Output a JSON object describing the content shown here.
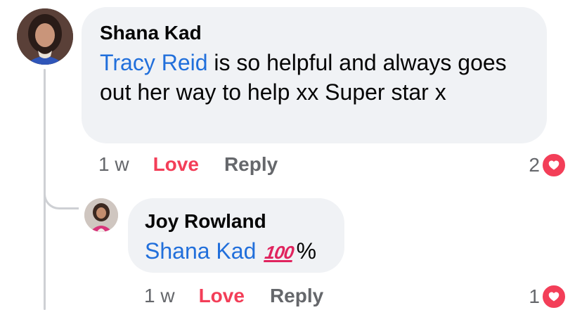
{
  "comment": {
    "author": "Shana Kad",
    "mention": "Tracy Reid",
    "text": " is so helpful and always goes out her way to help xx Super star x",
    "time": "1 w",
    "love_label": "Love",
    "reply_label": "Reply",
    "reaction_count": "2"
  },
  "reply": {
    "author": "Joy Rowland",
    "mention": "Shana Kad",
    "emoji": "100",
    "suffix": "%",
    "time": "1 w",
    "love_label": "Love",
    "reply_label": "Reply",
    "reaction_count": "1"
  },
  "icons": {
    "reaction": "heart-icon",
    "hundred": "hundred-points-emoji"
  },
  "colors": {
    "mention": "#216fdb",
    "love": "#f33e58",
    "bubble": "#f0f2f5",
    "meta": "#65676b"
  }
}
